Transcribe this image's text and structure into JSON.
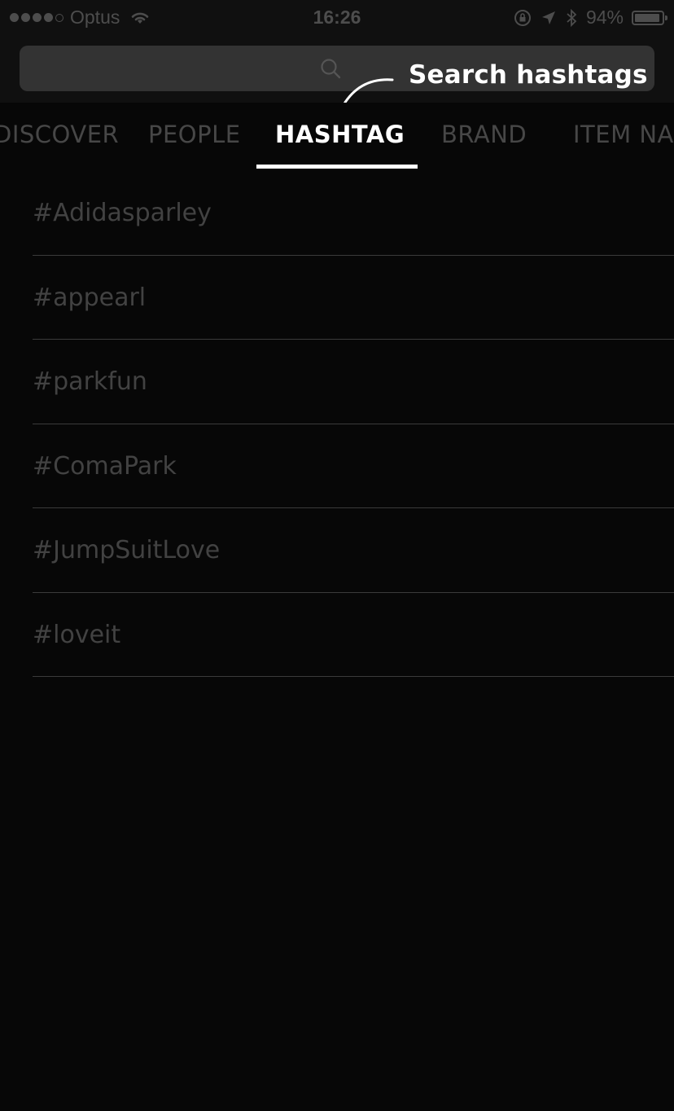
{
  "status_bar": {
    "carrier": "Optus",
    "time": "16:26",
    "battery_percent": "94%",
    "battery_level": 0.94,
    "signal_bars_filled": 4,
    "signal_bars_total": 5
  },
  "search": {
    "placeholder": "",
    "value": ""
  },
  "annotation": {
    "text": "Search hashtags"
  },
  "tabs": [
    {
      "label": "DISCOVER",
      "active": false
    },
    {
      "label": "PEOPLE",
      "active": false
    },
    {
      "label": "HASHTAG",
      "active": true
    },
    {
      "label": "BRAND",
      "active": false
    },
    {
      "label": "ITEM NA",
      "active": false
    }
  ],
  "hashtags": [
    {
      "label": "#Adidasparley"
    },
    {
      "label": "#appearl"
    },
    {
      "label": "#parkfun"
    },
    {
      "label": "#ComaPark"
    },
    {
      "label": "#JumpSuitLove"
    },
    {
      "label": "#loveit"
    }
  ],
  "colors": {
    "background": "#070707",
    "active_tab": "#ffffff",
    "inactive_text": "#474747",
    "divider": "#3a3a3a"
  }
}
